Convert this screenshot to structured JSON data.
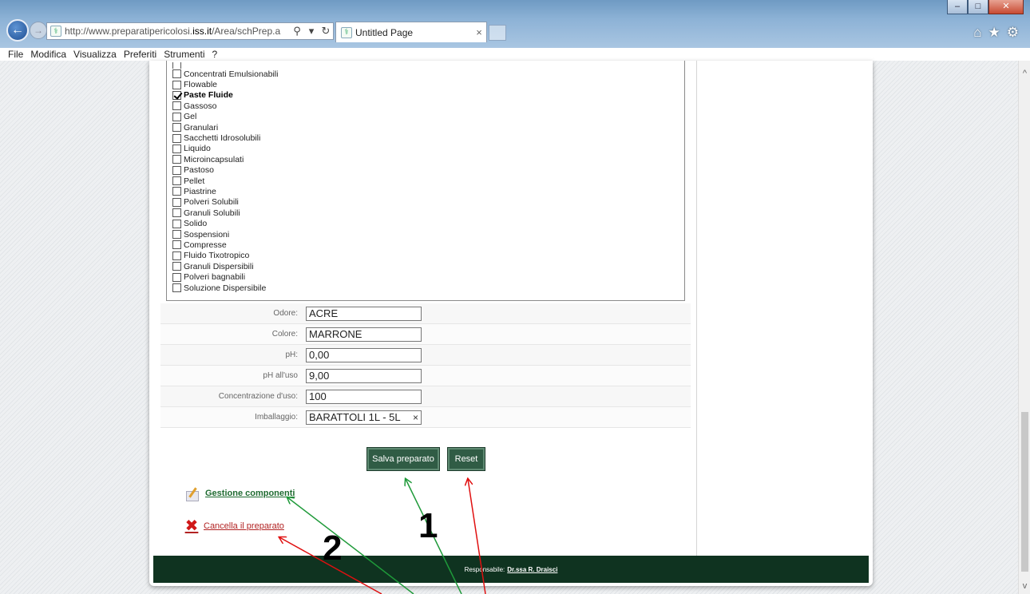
{
  "browser": {
    "url_prefix": "http://www.preparatipericolosi.",
    "url_domain": "iss.it",
    "url_suffix": "/Area/schPrep.a",
    "tab_title": "Untitled Page",
    "search_glyph": "⚲",
    "tab_close_glyph": "×",
    "menu": [
      "File",
      "Modifica",
      "Visualizza",
      "Preferiti",
      "Strumenti",
      "?"
    ]
  },
  "formulations": [
    {
      "label": "Concentrati Emulsionabili",
      "checked": false
    },
    {
      "label": "Flowable",
      "checked": false
    },
    {
      "label": "Paste Fluide",
      "checked": true
    },
    {
      "label": "Gassoso",
      "checked": false
    },
    {
      "label": "Gel",
      "checked": false
    },
    {
      "label": "Granulari",
      "checked": false
    },
    {
      "label": "Sacchetti Idrosolubili",
      "checked": false
    },
    {
      "label": "Liquido",
      "checked": false
    },
    {
      "label": "Microincapsulati",
      "checked": false
    },
    {
      "label": "Pastoso",
      "checked": false
    },
    {
      "label": "Pellet",
      "checked": false
    },
    {
      "label": "Piastrine",
      "checked": false
    },
    {
      "label": "Polveri Solubili",
      "checked": false
    },
    {
      "label": "Granuli Solubili",
      "checked": false
    },
    {
      "label": "Solido",
      "checked": false
    },
    {
      "label": "Sospensioni",
      "checked": false
    },
    {
      "label": "Compresse",
      "checked": false
    },
    {
      "label": "Fluido Tixotropico",
      "checked": false
    },
    {
      "label": "Granuli Dispersibili",
      "checked": false
    },
    {
      "label": "Polveri bagnabili",
      "checked": false
    },
    {
      "label": "Soluzione Dispersibile",
      "checked": false
    }
  ],
  "form": {
    "odore": {
      "label": "Odore:",
      "value": "ACRE"
    },
    "colore": {
      "label": "Colore:",
      "value": "MARRONE"
    },
    "ph": {
      "label": "pH:",
      "value": "0,00"
    },
    "ph_uso": {
      "label": "pH all'uso",
      "value": "9,00"
    },
    "concentrazione": {
      "label": "Concentrazione d'uso:",
      "value": "100"
    },
    "imballaggio": {
      "label": "Imballaggio:",
      "value": "BARATTOLI 1L - 5L",
      "clear": "×"
    }
  },
  "actions": {
    "save_label": "Salva preparato",
    "reset_label": "Reset",
    "manage_components": "Gestione componenti",
    "delete_preparation": "Cancella il preparato"
  },
  "footer": {
    "prefix": "Responsabile:",
    "name": "Dr.ssa R. Draisci"
  },
  "annotations": {
    "label_1": "1",
    "label_2": "2",
    "colors": {
      "green": "#1f9a3a",
      "red": "#e01010"
    }
  }
}
